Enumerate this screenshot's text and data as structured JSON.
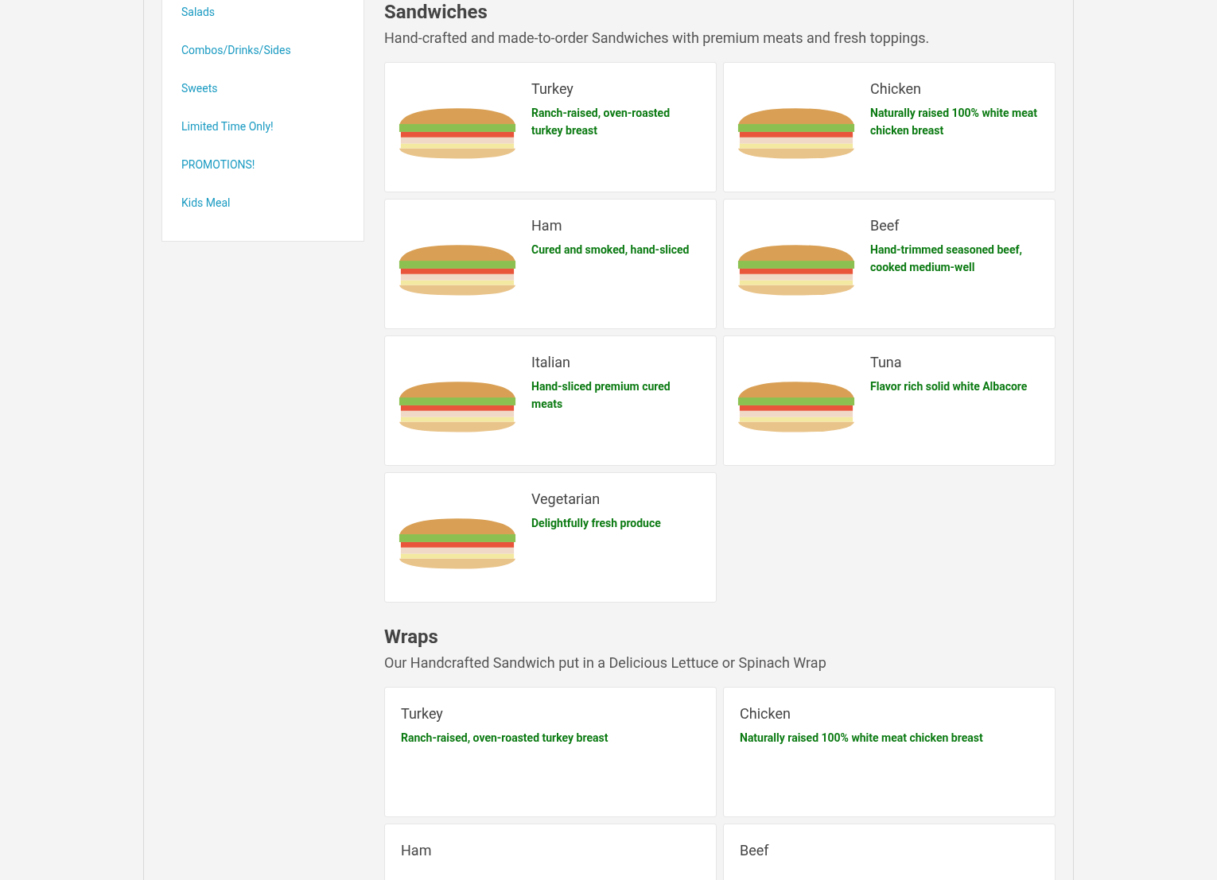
{
  "sidebar": {
    "items": [
      {
        "label": "Salads",
        "selected": false
      },
      {
        "label": "Combos/Drinks/Sides",
        "selected": false
      },
      {
        "label": "Sweets",
        "selected": false
      },
      {
        "label": "Limited Time Only!",
        "selected": false
      },
      {
        "label": "PROMOTIONS!",
        "selected": false
      },
      {
        "label": "Kids Meal",
        "selected": false
      }
    ]
  },
  "sections": [
    {
      "title": "Sandwiches",
      "subtitle": "Hand-crafted and made-to-order Sandwiches with premium meats and fresh toppings.",
      "with_images": true,
      "items": [
        {
          "name": "Turkey",
          "description": "Ranch-raised, oven-roasted turkey breast"
        },
        {
          "name": "Chicken",
          "description": "Naturally raised 100% white meat chicken breast"
        },
        {
          "name": "Ham",
          "description": "Cured and smoked, hand-sliced"
        },
        {
          "name": "Beef",
          "description": "Hand-trimmed seasoned beef, cooked medium-well"
        },
        {
          "name": "Italian",
          "description": "Hand-sliced premium cured meats"
        },
        {
          "name": "Tuna",
          "description": "Flavor rich solid white Albacore"
        },
        {
          "name": "Vegetarian",
          "description": "Delightfully fresh produce"
        }
      ]
    },
    {
      "title": "Wraps",
      "subtitle": "Our Handcrafted Sandwich put in a Delicious Lettuce or Spinach Wrap",
      "with_images": false,
      "items": [
        {
          "name": "Turkey",
          "description": "Ranch-raised, oven-roasted turkey breast"
        },
        {
          "name": "Chicken",
          "description": "Naturally raised 100% white meat chicken breast"
        },
        {
          "name": "Ham"
        },
        {
          "name": "Beef"
        }
      ]
    }
  ]
}
